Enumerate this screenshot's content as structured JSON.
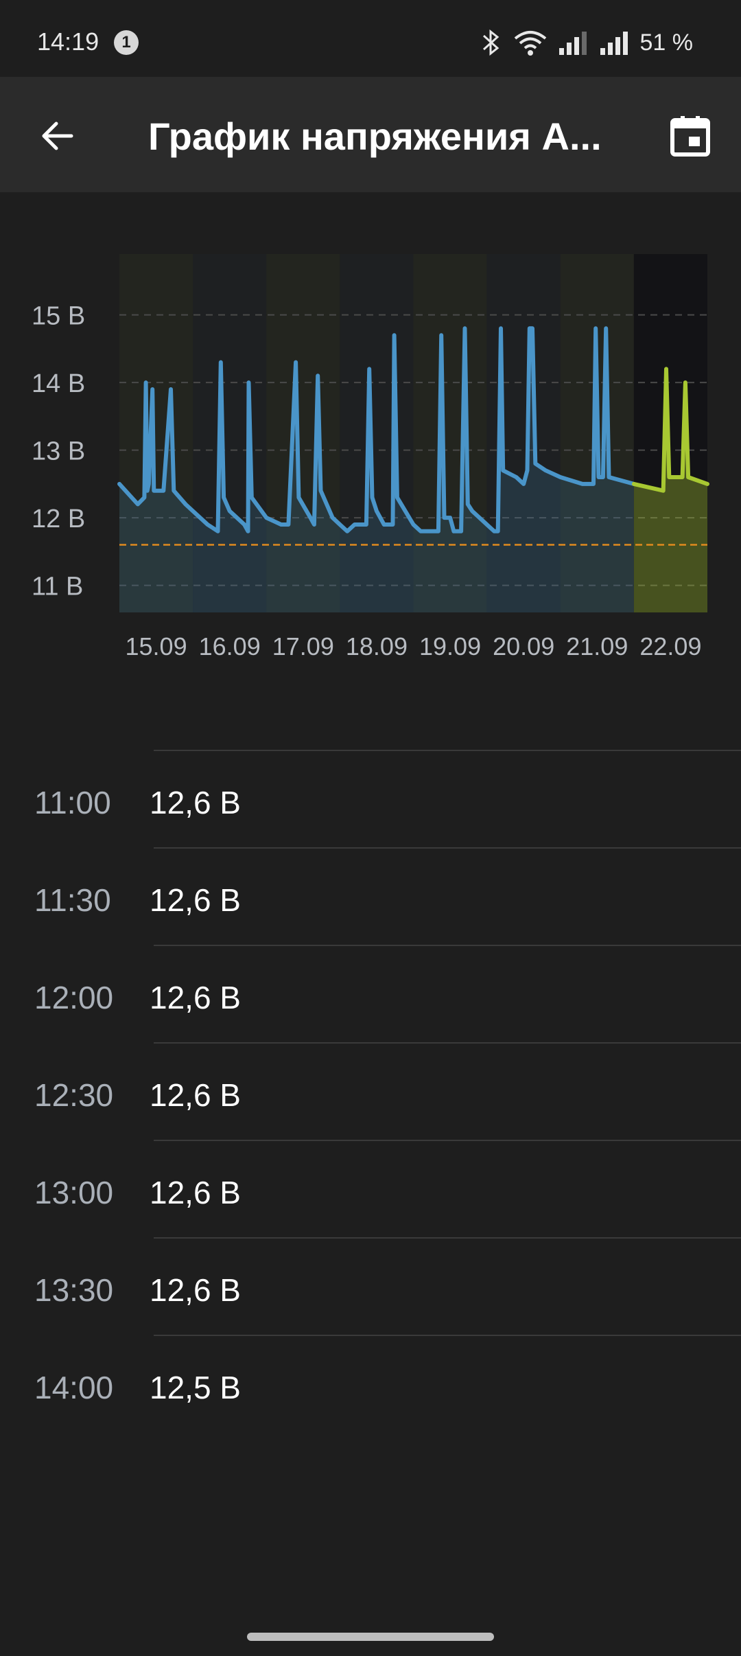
{
  "status_bar": {
    "time": "14:19",
    "notification_count": "1",
    "battery": "51 %",
    "icons": [
      "bluetooth-icon",
      "wifi-icon",
      "signal-icon",
      "signal-icon"
    ]
  },
  "app_bar": {
    "title": "График напряжения А...",
    "back_icon": "arrow-back-icon",
    "calendar_icon": "calendar-icon"
  },
  "chart_data": {
    "type": "line",
    "x": [
      "15.09",
      "16.09",
      "17.09",
      "18.09",
      "19.09",
      "20.09",
      "21.09",
      "22.09"
    ],
    "y_ticks": [
      "15 В",
      "14 В",
      "13 В",
      "12 В",
      "11 В"
    ],
    "ylim": [
      10.6,
      15.9
    ],
    "threshold": 11.6,
    "threshold_color": "#e08a1e",
    "series": [
      {
        "color": "#4a95c9",
        "points": [
          [
            0.0,
            12.5
          ],
          [
            0.25,
            12.2
          ],
          [
            0.34,
            12.3
          ],
          [
            0.36,
            14.0
          ],
          [
            0.38,
            12.4
          ],
          [
            0.4,
            12.5
          ],
          [
            0.45,
            13.9
          ],
          [
            0.47,
            12.4
          ],
          [
            0.6,
            12.4
          ],
          [
            0.7,
            13.9
          ],
          [
            0.74,
            12.4
          ],
          [
            0.9,
            12.2
          ],
          [
            1.0,
            12.1
          ],
          [
            1.2,
            11.9
          ],
          [
            1.34,
            11.8
          ],
          [
            1.38,
            14.3
          ],
          [
            1.42,
            12.3
          ],
          [
            1.5,
            12.1
          ],
          [
            1.7,
            11.9
          ],
          [
            1.75,
            11.8
          ],
          [
            1.76,
            14.0
          ],
          [
            1.8,
            12.3
          ],
          [
            2.0,
            12.0
          ],
          [
            2.2,
            11.9
          ],
          [
            2.3,
            11.9
          ],
          [
            2.4,
            14.3
          ],
          [
            2.44,
            12.3
          ],
          [
            2.6,
            12.0
          ],
          [
            2.65,
            11.9
          ],
          [
            2.7,
            14.1
          ],
          [
            2.74,
            12.4
          ],
          [
            2.9,
            12.0
          ],
          [
            3.0,
            11.9
          ],
          [
            3.1,
            11.8
          ],
          [
            3.2,
            11.9
          ],
          [
            3.36,
            11.9
          ],
          [
            3.4,
            14.2
          ],
          [
            3.44,
            12.3
          ],
          [
            3.5,
            12.1
          ],
          [
            3.6,
            11.9
          ],
          [
            3.72,
            11.9
          ],
          [
            3.74,
            14.7
          ],
          [
            3.78,
            12.3
          ],
          [
            4.0,
            11.9
          ],
          [
            4.1,
            11.8
          ],
          [
            4.15,
            11.8
          ],
          [
            4.34,
            11.8
          ],
          [
            4.38,
            14.7
          ],
          [
            4.42,
            12.0
          ],
          [
            4.5,
            12.0
          ],
          [
            4.55,
            11.8
          ],
          [
            4.65,
            11.8
          ],
          [
            4.7,
            14.8
          ],
          [
            4.74,
            12.2
          ],
          [
            4.8,
            12.1
          ],
          [
            5.0,
            11.9
          ],
          [
            5.1,
            11.8
          ],
          [
            5.15,
            11.8
          ],
          [
            5.19,
            14.8
          ],
          [
            5.22,
            12.7
          ],
          [
            5.4,
            12.6
          ],
          [
            5.5,
            12.5
          ],
          [
            5.55,
            12.7
          ],
          [
            5.58,
            14.8
          ],
          [
            5.62,
            14.8
          ],
          [
            5.66,
            12.8
          ],
          [
            5.8,
            12.7
          ],
          [
            6.0,
            12.6
          ],
          [
            6.3,
            12.5
          ],
          [
            6.45,
            12.5
          ],
          [
            6.48,
            14.8
          ],
          [
            6.52,
            12.6
          ],
          [
            6.58,
            12.6
          ],
          [
            6.62,
            14.8
          ],
          [
            6.66,
            12.6
          ],
          [
            7.0,
            12.5
          ]
        ]
      },
      {
        "color": "#a8c832",
        "points": [
          [
            7.0,
            12.5
          ],
          [
            7.2,
            12.45
          ],
          [
            7.4,
            12.4
          ],
          [
            7.44,
            14.2
          ],
          [
            7.48,
            12.6
          ],
          [
            7.66,
            12.6
          ],
          [
            7.7,
            14.0
          ],
          [
            7.74,
            12.6
          ],
          [
            8.0,
            12.5
          ]
        ]
      }
    ]
  },
  "list": [
    {
      "time": "11:00",
      "value": "12,6 В"
    },
    {
      "time": "11:30",
      "value": "12,6 В"
    },
    {
      "time": "12:00",
      "value": "12,6 В"
    },
    {
      "time": "12:30",
      "value": "12,6 В"
    },
    {
      "time": "13:00",
      "value": "12,6 В"
    },
    {
      "time": "13:30",
      "value": "12,6 В"
    },
    {
      "time": "14:00",
      "value": "12,5 В"
    }
  ],
  "colors": {
    "background": "#1e1e1e",
    "app_bar": "#2b2b2b",
    "accent_blue": "#4a95c9",
    "accent_green": "#a8c832"
  }
}
